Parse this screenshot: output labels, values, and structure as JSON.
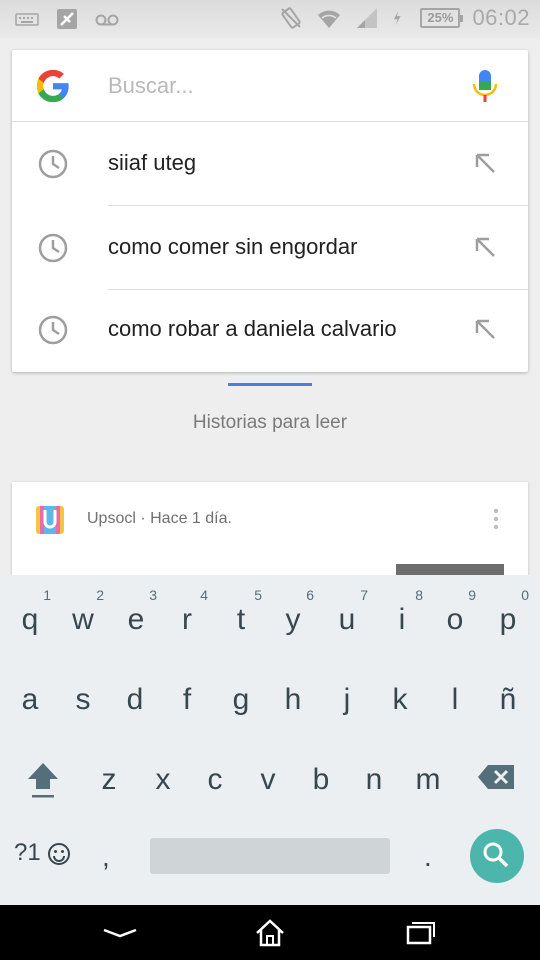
{
  "status_bar": {
    "battery_percent": "25%",
    "time": "06:02",
    "icons": [
      "keyboard-icon",
      "satellite-icon",
      "voicemail-icon",
      "vibrate-icon",
      "wifi-icon",
      "signal-icon",
      "charging-icon",
      "battery-icon"
    ]
  },
  "search": {
    "placeholder": "Buscar...",
    "value": "",
    "suggestions": [
      {
        "text": "siiaf uteg"
      },
      {
        "text": "como comer sin engordar"
      },
      {
        "text": "como robar a daniela calvario"
      }
    ]
  },
  "stories": {
    "label": "Historias para leer",
    "card": {
      "source": "Upsocl",
      "time": "Hace 1 día.",
      "meta": "Upsocl · Hace 1 día."
    }
  },
  "keyboard": {
    "row1": [
      {
        "ch": "q",
        "hint": "1"
      },
      {
        "ch": "w",
        "hint": "2"
      },
      {
        "ch": "e",
        "hint": "3"
      },
      {
        "ch": "r",
        "hint": "4"
      },
      {
        "ch": "t",
        "hint": "5"
      },
      {
        "ch": "y",
        "hint": "6"
      },
      {
        "ch": "u",
        "hint": "7"
      },
      {
        "ch": "i",
        "hint": "8"
      },
      {
        "ch": "o",
        "hint": "9"
      },
      {
        "ch": "p",
        "hint": "0"
      }
    ],
    "row2": [
      "a",
      "s",
      "d",
      "f",
      "g",
      "h",
      "j",
      "k",
      "l",
      "ñ"
    ],
    "row3": [
      "z",
      "x",
      "c",
      "v",
      "b",
      "n",
      "m"
    ],
    "symbols_label": "?1",
    "comma": ",",
    "period": "."
  },
  "colors": {
    "accent_blue": "#4a7fd9",
    "search_key": "#4db6ac",
    "keyboard_bg": "#eceff1"
  }
}
